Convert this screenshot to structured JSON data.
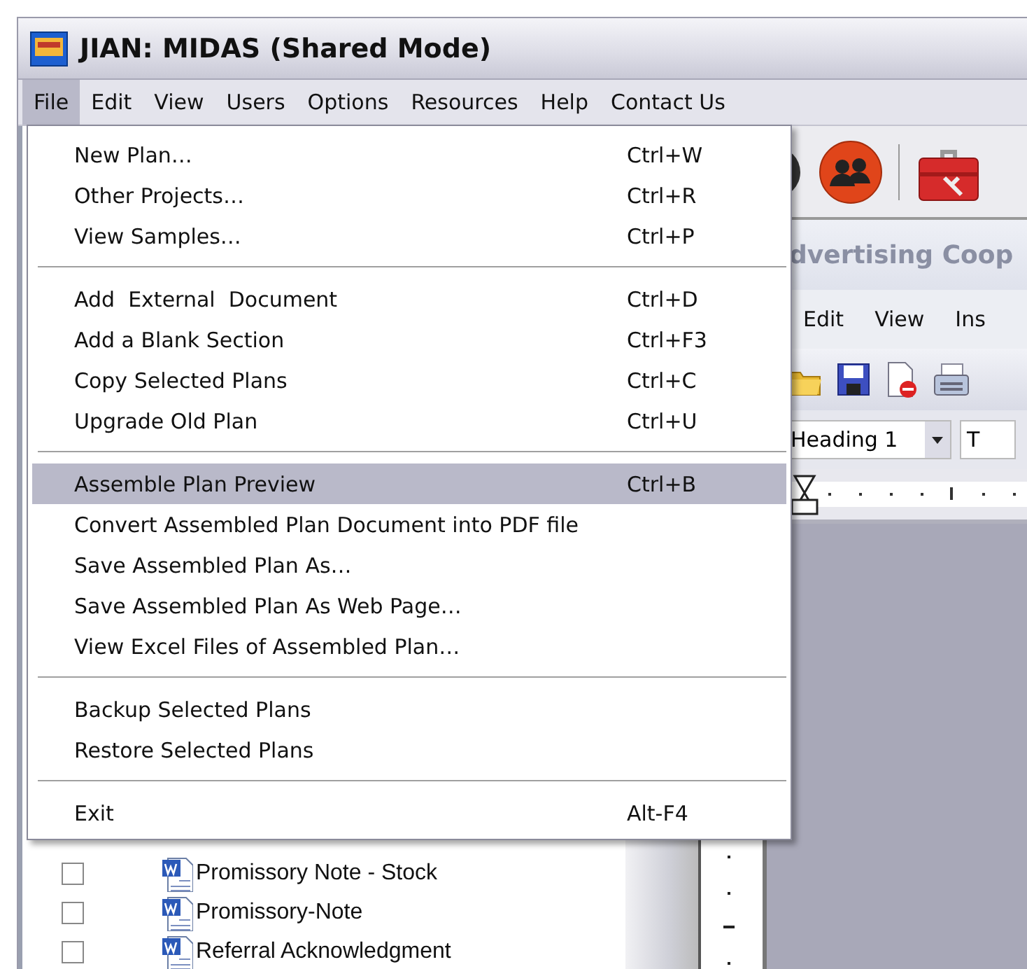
{
  "window": {
    "title": "JIAN: MIDAS (Shared Mode)"
  },
  "menu_bar": [
    {
      "label": "File",
      "selected": true
    },
    {
      "label": "Edit",
      "selected": false
    },
    {
      "label": "View",
      "selected": false
    },
    {
      "label": "Users",
      "selected": false
    },
    {
      "label": "Options",
      "selected": false
    },
    {
      "label": "Resources",
      "selected": false
    },
    {
      "label": "Help",
      "selected": false
    },
    {
      "label": "Contact Us",
      "selected": false
    }
  ],
  "file_menu": [
    [
      {
        "label": "New Plan…",
        "shortcut": "Ctrl+W",
        "selected": false
      },
      {
        "label": "Other Projects…",
        "shortcut": "Ctrl+R",
        "selected": false
      },
      {
        "label": "View Samples…",
        "shortcut": "Ctrl+P",
        "selected": false
      }
    ],
    [
      {
        "label": "Add  External  Document",
        "shortcut": "Ctrl+D",
        "selected": false
      },
      {
        "label": "Add a Blank Section",
        "shortcut": "Ctrl+F3",
        "selected": false
      },
      {
        "label": "Copy Selected Plans",
        "shortcut": "Ctrl+C",
        "selected": false
      },
      {
        "label": "Upgrade Old Plan",
        "shortcut": "Ctrl+U",
        "selected": false
      }
    ],
    [
      {
        "label": "Assemble Plan Preview",
        "shortcut": "Ctrl+B",
        "selected": true
      },
      {
        "label": "Convert Assembled Plan Document into PDF file",
        "selected": false
      },
      {
        "label": "Save Assembled Plan As…",
        "selected": false
      },
      {
        "label": "Save Assembled Plan As Web Page…",
        "selected": false
      },
      {
        "label": "View Excel Files of Assembled Plan…",
        "selected": false
      }
    ],
    [
      {
        "label": "Backup Selected Plans",
        "selected": false
      },
      {
        "label": "Restore Selected Plans",
        "selected": false
      }
    ],
    [
      {
        "label": "Exit",
        "shortcut": "Alt-F4",
        "selected": false
      }
    ]
  ],
  "document_window": {
    "title": "dvertising Coop",
    "menu": [
      "Edit",
      "View",
      "Ins"
    ],
    "style_box": "Heading 1",
    "font_box": "T"
  },
  "plan_list": [
    {
      "label": "Promissory Note - Stock",
      "checked": false
    },
    {
      "label": "Promissory-Note",
      "checked": false
    },
    {
      "label": "Referral Acknowledgment",
      "checked": false
    }
  ]
}
